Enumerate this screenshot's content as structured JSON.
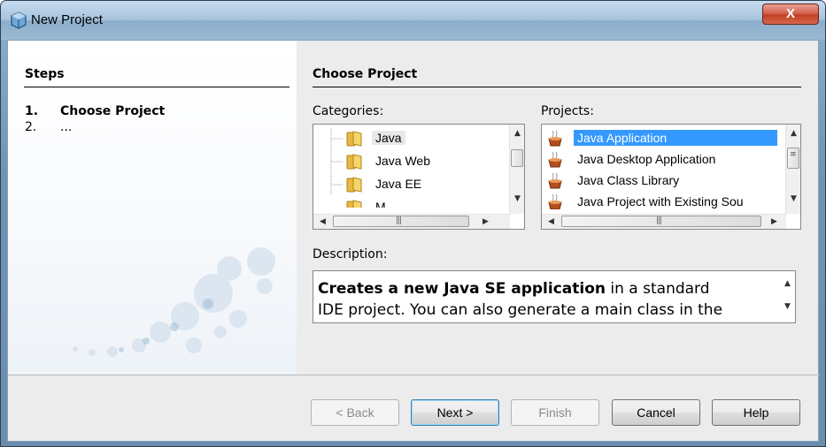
{
  "window": {
    "title": "New Project",
    "close_label": "X"
  },
  "steps": {
    "title": "Steps",
    "items": [
      {
        "num": "1.",
        "label": "Choose Project"
      },
      {
        "num": "2.",
        "label": "..."
      }
    ]
  },
  "main": {
    "section_title": "Choose Project",
    "categories": {
      "label": "Categories:",
      "items": [
        "Java",
        "Java Web",
        "Java EE",
        "M..."
      ],
      "selected": "Java"
    },
    "projects": {
      "label": "Projects:",
      "items": [
        "Java Application",
        "Java Desktop Application",
        "Java Class Library",
        "Java Project with Existing Sou"
      ],
      "selected": "Java Application"
    },
    "description": {
      "label": "Description:",
      "bold_text": "Creates a new Java SE application",
      "rest_line1": " in a standard",
      "line2": "IDE project. You can also generate a main class in the"
    }
  },
  "buttons": {
    "back": "< Back",
    "next": "Next >",
    "finish": "Finish",
    "cancel": "Cancel",
    "help": "Help"
  },
  "colors": {
    "selection": "#3399ff",
    "accent": "#3c7fb1"
  }
}
